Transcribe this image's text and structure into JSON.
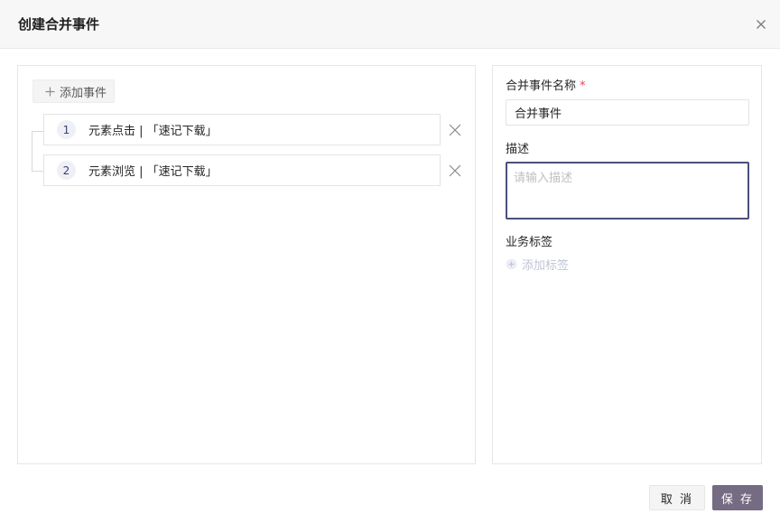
{
  "dialog": {
    "title": "创建合并事件",
    "close_icon": "close-icon"
  },
  "left_panel": {
    "add_event_label": "添加事件",
    "events": [
      {
        "index": "1",
        "text": "元素点击 | 「速记下载」"
      },
      {
        "index": "2",
        "text": "元素浏览 | 「速记下载」"
      }
    ]
  },
  "right_panel": {
    "name_label": "合并事件名称",
    "required_mark": "*",
    "name_value": "合并事件",
    "desc_label": "描述",
    "desc_placeholder": "请输入描述",
    "tags_label": "业务标签",
    "add_tag_label": "添加标签"
  },
  "footer": {
    "cancel_label": "取 消",
    "save_label": "保 存"
  },
  "colors": {
    "primary": "#756b82",
    "focus_border": "#4a4f7a",
    "required": "#e5484d"
  }
}
